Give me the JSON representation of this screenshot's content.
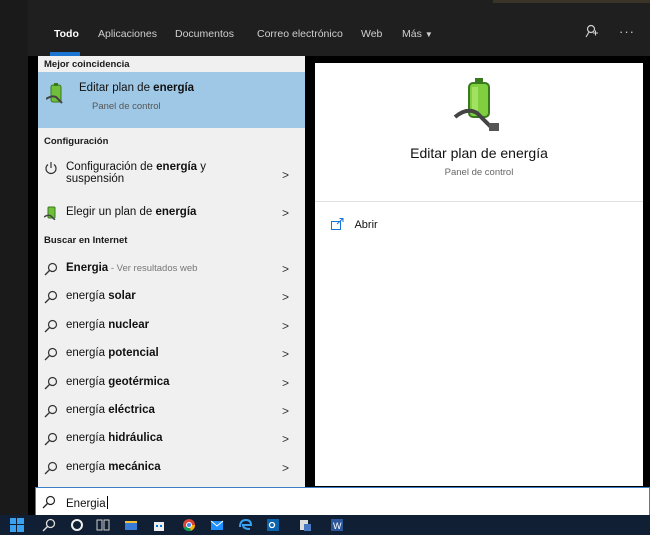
{
  "tabs": [
    {
      "label": "Todo",
      "active": true
    },
    {
      "label": "Aplicaciones"
    },
    {
      "label": "Documentos"
    },
    {
      "label": "Correo electrónico"
    },
    {
      "label": "Web"
    },
    {
      "label": "Más"
    }
  ],
  "top_icons": [
    "feedback-icon",
    "more-options-icon"
  ],
  "sections": {
    "best_match": "Mejor coincidencia",
    "settings": "Configuración",
    "web": "Buscar en Internet"
  },
  "best_match": {
    "title_prefix": "Editar plan de ",
    "title_bold": "energía",
    "subtitle": "Panel de control",
    "icon": "power-plan-battery-icon"
  },
  "settings_items": [
    {
      "prefix": "Configuración de ",
      "bold": "energía",
      "after": " y",
      "line2": "suspensión",
      "icon": "power-icon"
    },
    {
      "prefix": "Elegir un plan de ",
      "bold": "energía",
      "icon": "power-plan-battery-icon"
    }
  ],
  "web_items": [
    {
      "prefix": "",
      "bold": "Energia",
      "suffix": " - Ver resultados web"
    },
    {
      "prefix": "energía ",
      "bold": "solar"
    },
    {
      "prefix": "energía ",
      "bold": "nuclear"
    },
    {
      "prefix": "energía ",
      "bold": "potencial"
    },
    {
      "prefix": "energía ",
      "bold": "geotérmica"
    },
    {
      "prefix": "energía ",
      "bold": "eléctrica"
    },
    {
      "prefix": "energía ",
      "bold": "hidráulica"
    },
    {
      "prefix": "energía ",
      "bold": "mecánica"
    }
  ],
  "preview": {
    "title": "Editar plan de energía",
    "subtitle": "Panel de control",
    "actions": [
      {
        "label": "Abrir",
        "icon": "open-icon"
      }
    ]
  },
  "search": {
    "value": "Energia"
  },
  "taskbar_icons": [
    "windows-start-icon",
    "search-icon",
    "task-view-icon",
    "widgets-icon",
    "file-explorer-icon",
    "store-icon",
    "chrome-icon",
    "mail-icon",
    "edge-icon",
    "outlook-icon",
    "app-icon",
    "word-icon"
  ],
  "colors": {
    "accent": "#1a75d2",
    "selected": "#9fc8e6",
    "taskbar": "#101f33"
  }
}
